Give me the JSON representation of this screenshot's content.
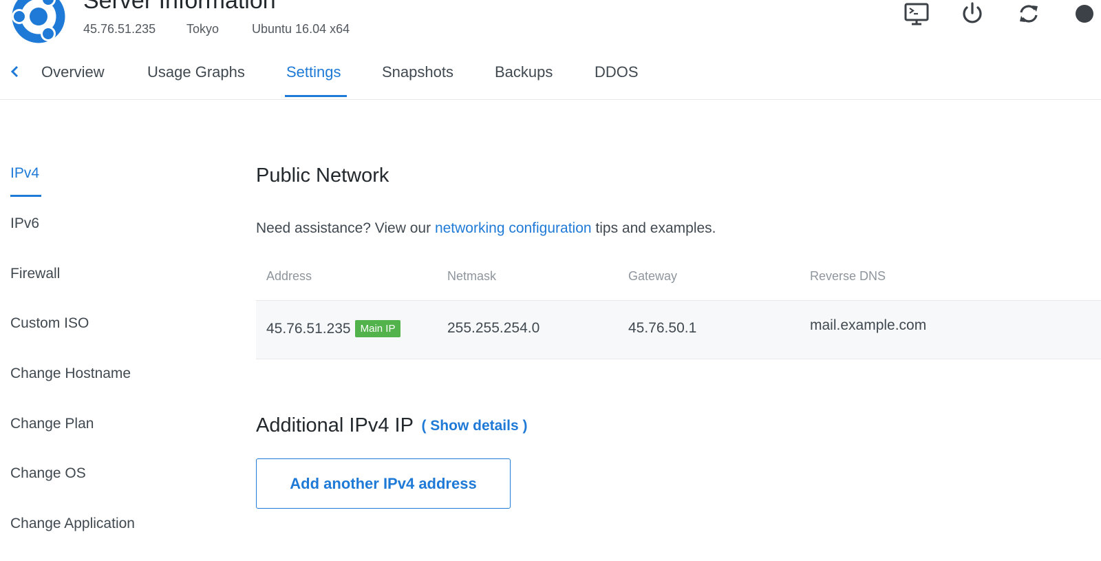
{
  "header": {
    "title": "Server Information",
    "ip": "45.76.51.235",
    "location": "Tokyo",
    "os": "Ubuntu 16.04 x64",
    "logo_icon": "ubuntu-logo-icon",
    "actions": [
      {
        "name": "console",
        "icon": "monitor-console-icon"
      },
      {
        "name": "power",
        "icon": "power-icon"
      },
      {
        "name": "restart",
        "icon": "restart-icon"
      },
      {
        "name": "more",
        "icon": "more-icon"
      }
    ]
  },
  "tabs": [
    {
      "label": "Overview"
    },
    {
      "label": "Usage Graphs"
    },
    {
      "label": "Settings",
      "active": true
    },
    {
      "label": "Snapshots"
    },
    {
      "label": "Backups"
    },
    {
      "label": "DDOS"
    }
  ],
  "sidebar": {
    "items": [
      {
        "label": "IPv4",
        "active": true
      },
      {
        "label": "IPv6"
      },
      {
        "label": "Firewall"
      },
      {
        "label": "Custom ISO"
      },
      {
        "label": "Change Hostname"
      },
      {
        "label": "Change Plan"
      },
      {
        "label": "Change OS"
      },
      {
        "label": "Change Application"
      }
    ]
  },
  "main": {
    "public_network": {
      "title": "Public Network",
      "assist_prefix": "Need assistance? View our ",
      "assist_link": "networking configuration",
      "assist_suffix": " tips and examples.",
      "columns": [
        "Address",
        "Netmask",
        "Gateway",
        "Reverse DNS"
      ],
      "row": {
        "address": "45.76.51.235",
        "badge": "Main IP",
        "netmask": "255.255.254.0",
        "gateway": "45.76.50.1",
        "reverse_dns": "mail.example.com"
      }
    },
    "additional": {
      "title": "Additional IPv4 IP",
      "show_details": "( Show details )",
      "add_button": "Add another IPv4 address"
    }
  },
  "colors": {
    "accent": "#1e7ad6",
    "badge": "#52b24b",
    "text": "#414950",
    "heading": "#23282d"
  }
}
